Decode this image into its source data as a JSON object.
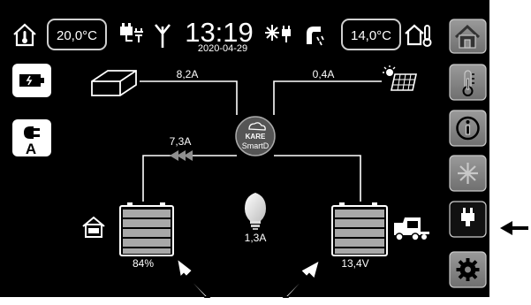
{
  "status_bar": {
    "indoor_temp": "20,0°C",
    "time": "13:19",
    "date": "2020-04-29",
    "outdoor_temp": "14,0°C"
  },
  "flow": {
    "inverter_current": "8,2A",
    "solar_current": "0,4A",
    "battery_flow_current": "7,3A",
    "hub_brand": "KARE",
    "hub_name": "SmartD",
    "load_current": "1,3A",
    "house_battery_percent": "84%",
    "engine_battery_voltage": "13,4V"
  },
  "side_menu": {
    "items": [
      "home-icon",
      "thermometer-icon",
      "info-icon",
      "snowflake-icon",
      "plug-icon",
      "gear-icon"
    ],
    "active": "plug-icon"
  },
  "left_buttons": [
    "battery-charge-icon",
    "plug-current-icon"
  ],
  "colors": {
    "background": "#000000",
    "panel_bg": "#050505",
    "line": "#ffffff",
    "battery_fill": "#a8a8a8",
    "side_button": "#8a8a8a",
    "side_button_active": "#111111"
  }
}
